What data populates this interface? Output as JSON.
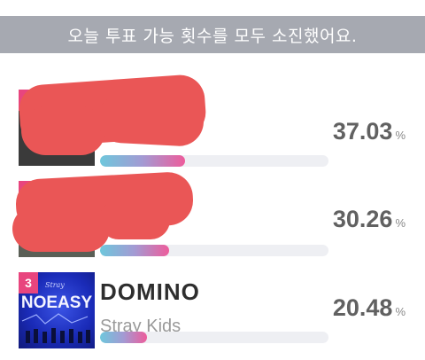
{
  "banner": {
    "text": "오늘 투표 가능 횟수를 모두 소진했어요."
  },
  "unit": "%",
  "entries": [
    {
      "rank": "",
      "title": "",
      "artist": "",
      "percent": "37.03",
      "share": 0.3703,
      "redacted": true
    },
    {
      "rank": "",
      "title": "",
      "artist": "",
      "percent": "30.26",
      "share": 0.3026,
      "redacted": true
    },
    {
      "rank": "3",
      "title": "DOMINO",
      "artist": "Stray Kids",
      "percent": "20.48",
      "share": 0.2048,
      "redacted": false,
      "cover_text": "NOEASY",
      "cover_small_text": "Stray"
    }
  ],
  "colors": {
    "accent_pink": "#e8457e",
    "bar_start": "#6ec7dc",
    "bar_end": "#ee5c9b",
    "redaction": "#ea5656",
    "banner_bg": "#a6a9b1"
  }
}
